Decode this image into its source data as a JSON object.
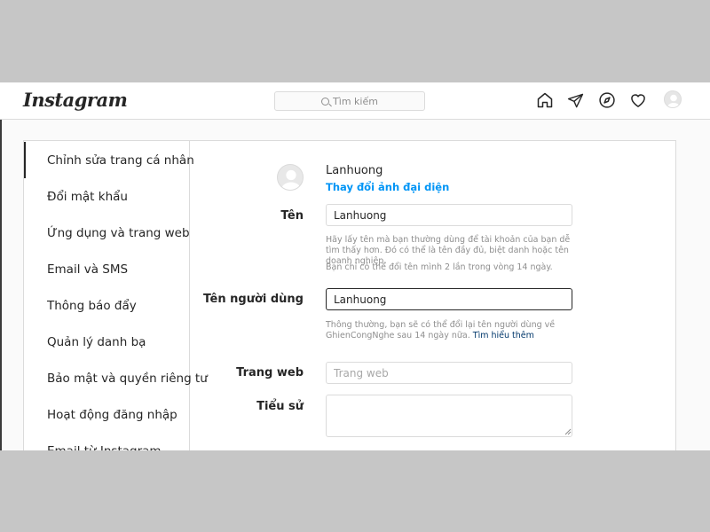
{
  "app": {
    "logo": "Instagram"
  },
  "search": {
    "placeholder": "Tìm kiếm"
  },
  "nav_icons": [
    "home-icon",
    "direct-message-icon",
    "explore-icon",
    "activity-heart-icon",
    "profile-avatar"
  ],
  "sidebar": {
    "items": [
      {
        "label": "Chỉnh sửa trang cá nhân",
        "active": true
      },
      {
        "label": "Đổi mật khẩu"
      },
      {
        "label": "Ứng dụng và trang web"
      },
      {
        "label": "Email và SMS"
      },
      {
        "label": "Thông báo đẩy"
      },
      {
        "label": "Quản lý danh bạ"
      },
      {
        "label": "Bảo mật và quyền riêng tư"
      },
      {
        "label": "Hoạt động đăng nhập"
      },
      {
        "label": "Email từ Instagram"
      }
    ]
  },
  "profile": {
    "username_display": "Lanhuong",
    "change_photo": "Thay đổi ảnh đại diện"
  },
  "form": {
    "name": {
      "label": "Tên",
      "value": "Lanhuong",
      "help1": "Hãy lấy tên mà bạn thường dùng để tài khoản của bạn dễ tìm thấy hơn. Đó có thể là tên đầy đủ, biệt danh hoặc tên doanh nghiệp.",
      "help2": "Bạn chỉ có thể đổi tên mình 2 lần trong vòng 14 ngày."
    },
    "username": {
      "label": "Tên người dùng",
      "value": "Lanhuong",
      "help": "Thông thường, bạn sẽ có thể đổi lại tên người dùng về GhienCongNghe sau 14 ngày nữa.",
      "help_link": "Tìm hiểu thêm"
    },
    "website": {
      "label": "Trang web",
      "placeholder": "Trang web",
      "value": ""
    },
    "bio": {
      "label": "Tiểu sử",
      "value": ""
    }
  },
  "colors": {
    "accent_link": "#0095f6",
    "help_link": "#00376b",
    "border": "#dbdbdb",
    "text": "#262626",
    "muted": "#8e8e8e",
    "letterbox": "#c6c6c6"
  }
}
